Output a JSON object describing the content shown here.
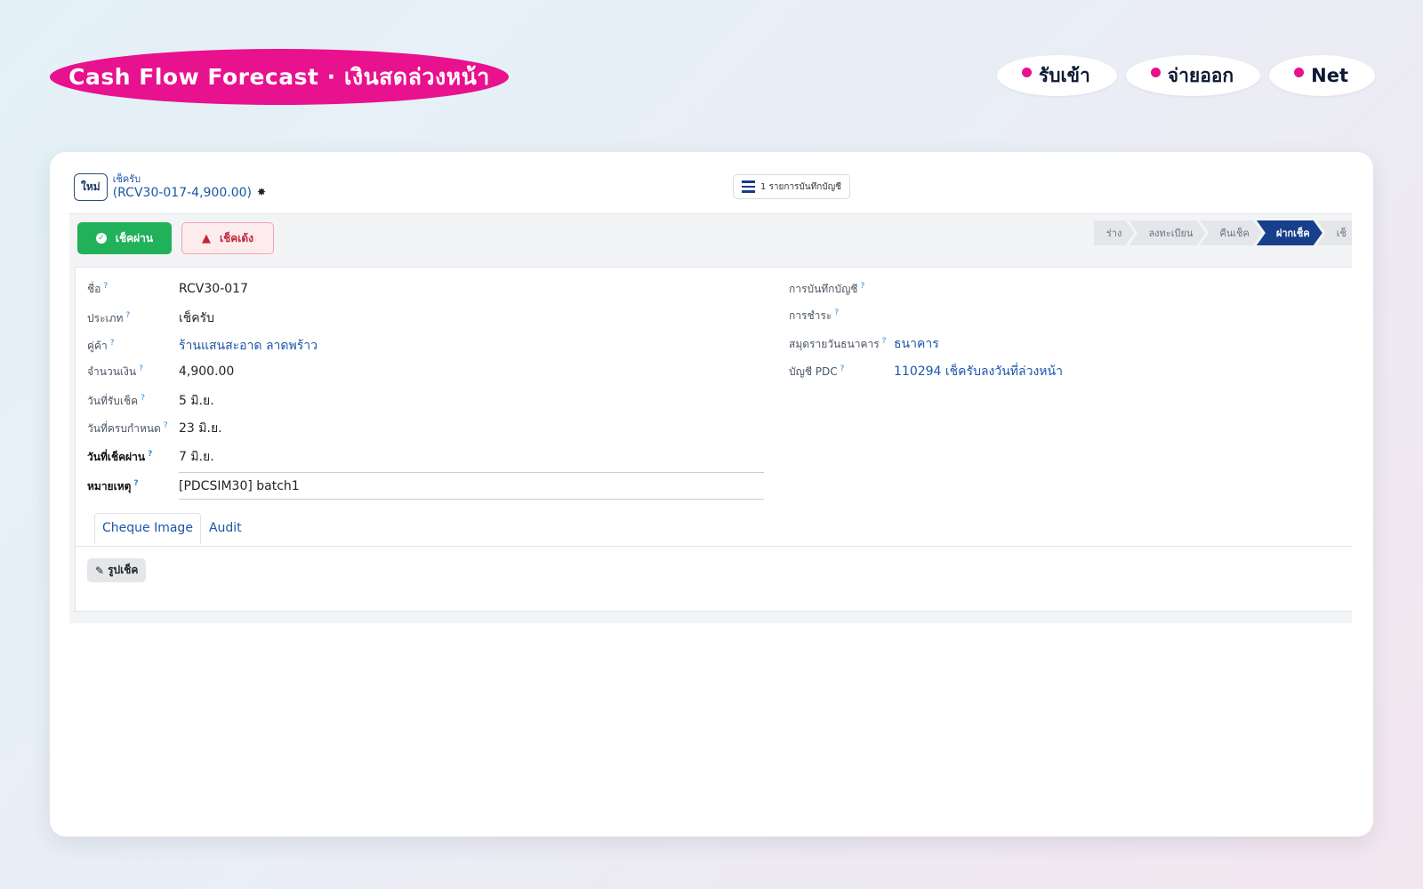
{
  "hero": {
    "title": "Cash Flow Forecast · เงินสดล่วงหน้า",
    "legend": [
      "รับเข้า",
      "จ่ายออก",
      "Net"
    ],
    "accent_color": "#e8118e"
  },
  "header": {
    "new_button": "ใหม่",
    "breadcrumb_parent": "เช็ครับ",
    "record_title": "(RCV30-017-4,900.00)",
    "gear_icon": "gear-icon",
    "journal_button": "1 รายการบันทึกบัญชี"
  },
  "actions": {
    "pass_button": "เช็คผ่าน",
    "bounce_button": "เช็คเด้ง"
  },
  "status_steps": [
    "ร่าง",
    "ลงทะเบียน",
    "คืนเช็ค",
    "ฝากเช็ค",
    "เช็"
  ],
  "status_active_index": 3,
  "form": {
    "left": [
      {
        "label": "ชื่อ",
        "value": "RCV30-017"
      },
      {
        "label": "ประเภท",
        "value": "เช็ครับ"
      },
      {
        "label": "คู่ค้า",
        "value": "ร้านแสนสะอาด ลาดพร้าว"
      },
      {
        "label": "จำนวนเงิน",
        "value": "4,900.00"
      },
      {
        "label": "วันที่รับเช็ค",
        "value": "5 มิ.ย."
      },
      {
        "label": "วันที่ครบกำหนด",
        "value": "23 มิ.ย."
      },
      {
        "label": "วันที่เช็คผ่าน",
        "value": "7 มิ.ย."
      },
      {
        "label": "หมายเหตุ",
        "value": "[PDCSIM30] batch1"
      }
    ],
    "right": [
      {
        "label": "การบันทึกบัญชี",
        "value": ""
      },
      {
        "label": "การชำระ",
        "value": ""
      },
      {
        "label": "สมุดรายวันธนาคาร",
        "value": "ธนาคาร"
      },
      {
        "label": "บัญชี PDC",
        "value": "110294 เช็ครับลงวันที่ล่วงหน้า"
      }
    ]
  },
  "tabs": [
    "Cheque Image",
    "Audit"
  ],
  "attachment": {
    "label": "รูปเช็ค",
    "icon": "paperclip-icon"
  }
}
